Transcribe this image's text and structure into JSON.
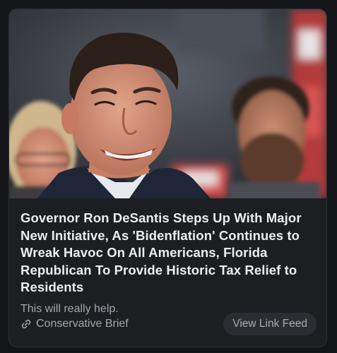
{
  "card": {
    "image_alt": "Governor Ron DeSantis smiling at an event",
    "headline": "Governor Ron DeSantis Steps Up With Major New Initiative, As 'Bidenflation' Continues to Wreak Havoc On All Americans, Florida Republican To Provide Historic Tax Relief to Residents",
    "subtitle": "This will really help.",
    "source": {
      "icon": "link-icon",
      "name": "Conservative Brief"
    },
    "action_button": {
      "label": "View Link Feed"
    }
  },
  "colors": {
    "background": "#131519",
    "card": "#1c1e22",
    "headline": "#eceef1",
    "muted_text": "#a3a7ae",
    "button": "#2a2d32"
  }
}
